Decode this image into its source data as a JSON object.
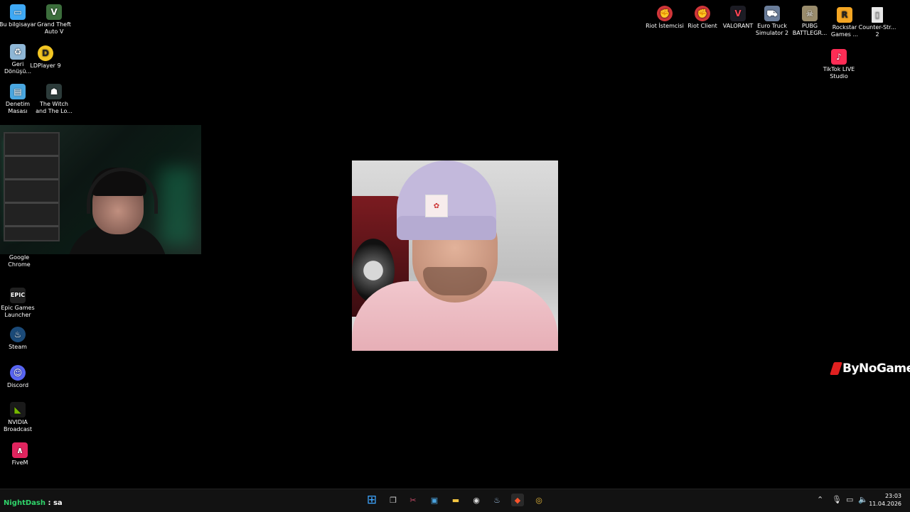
{
  "desktop_icons_left": [
    {
      "label": "Bu bilgisayar",
      "icon": "computer-icon",
      "color": "#3fa9f5"
    },
    {
      "label": "Grand Theft\nAuto V",
      "icon": "gta-icon",
      "color": "#3c6e3c"
    },
    {
      "label": "Geri\nDönüşü...",
      "icon": "recycle-bin-icon",
      "color": "#8fb7d6"
    },
    {
      "label": "LDPlayer 9",
      "icon": "ldplayer-icon",
      "color": "#f3c623"
    },
    {
      "label": "Denetim\nMasası",
      "icon": "control-panel-icon",
      "color": "#4aa7e0"
    },
    {
      "label": "The Witch\nand The Lo...",
      "icon": "witch-game-icon",
      "color": "#2c3b3a"
    },
    {
      "label": "Google\nChrome",
      "icon": "chrome-icon",
      "color": "#e8b93a"
    },
    {
      "label": "Epic Games\nLauncher",
      "icon": "epic-games-icon",
      "color": "#202020"
    },
    {
      "label": "Steam",
      "icon": "steam-icon",
      "color": "#1b4a78"
    },
    {
      "label": "Discord",
      "icon": "discord-icon",
      "color": "#5865f2"
    },
    {
      "label": "NVIDIA\nBroadcast",
      "icon": "nvidia-icon",
      "color": "#76b900"
    },
    {
      "label": "FiveM",
      "icon": "fivem-icon",
      "color": "#e0245e"
    }
  ],
  "desktop_icons_right": [
    {
      "label": "Riot İstemcisi",
      "icon": "riot-icon",
      "color": "#d13639"
    },
    {
      "label": "Riot Client",
      "icon": "riot-client-icon",
      "color": "#d13639"
    },
    {
      "label": "VALORANT",
      "icon": "valorant-icon",
      "color": "#fa4454"
    },
    {
      "label": "Euro Truck\nSimulator 2",
      "icon": "ets2-icon",
      "color": "#6a7d9a"
    },
    {
      "label": "PUBG\nBATTLEGR...",
      "icon": "pubg-icon",
      "color": "#9a8c6c"
    },
    {
      "label": "Rockstar\nGames ...",
      "icon": "rockstar-icon",
      "color": "#f5a623"
    },
    {
      "label": "Counter-Str...\n2",
      "icon": "file-icon",
      "color": "#e8e8e8"
    },
    {
      "label": "TikTok LIVE\nStudio",
      "icon": "tiktok-live-icon",
      "color": "#fe2c55"
    }
  ],
  "brand": {
    "text": "ByNoGame",
    "accent": "#e02020"
  },
  "chat": {
    "user": "NightDash",
    "separator": " :",
    "message": " sa",
    "user_color": "#2fd46a"
  },
  "taskbar": {
    "apps": [
      {
        "name": "start-icon",
        "glyph": "⊞",
        "color": "#3ea6ff"
      },
      {
        "name": "task-view-icon",
        "glyph": "❐",
        "color": "#cfcfcf"
      },
      {
        "name": "snipping-tool-icon",
        "glyph": "✂",
        "color": "#c94d6a"
      },
      {
        "name": "photos-icon",
        "glyph": "▣",
        "color": "#4aa3df"
      },
      {
        "name": "file-explorer-icon",
        "glyph": "▬",
        "color": "#f4c542"
      },
      {
        "name": "obs-icon",
        "glyph": "◉",
        "color": "#dddddd"
      },
      {
        "name": "steam-icon",
        "glyph": "♨",
        "color": "#9fc3e5"
      },
      {
        "name": "brave-icon",
        "glyph": "◆",
        "color": "#fb542b"
      },
      {
        "name": "chrome-icon",
        "glyph": "◎",
        "color": "#e8b93a"
      }
    ],
    "clock_time": "23:03",
    "clock_date": "11.04.2026"
  }
}
